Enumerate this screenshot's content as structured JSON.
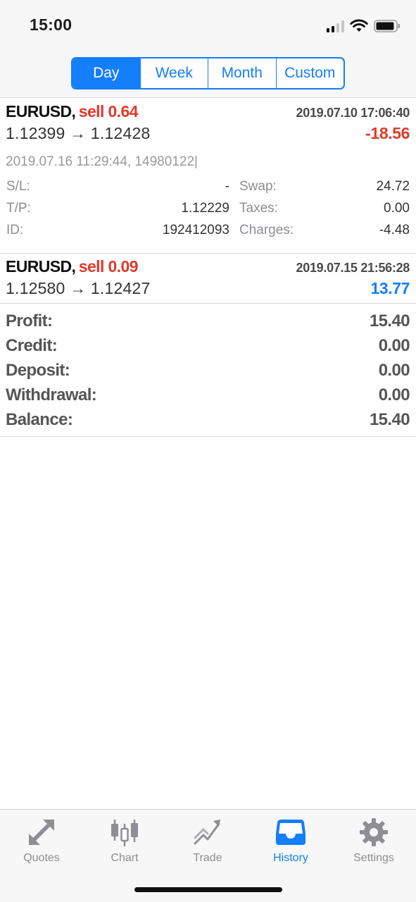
{
  "status_bar": {
    "time": "15:00"
  },
  "segments": [
    {
      "label": "Day",
      "active": true
    },
    {
      "label": "Week",
      "active": false
    },
    {
      "label": "Month",
      "active": false
    },
    {
      "label": "Custom",
      "active": false
    }
  ],
  "trades": [
    {
      "symbol": "EURUSD,",
      "side": "sell 0.64",
      "open_time": "2019.07.10 17:06:40",
      "prices": "1.12399 → 1.12428",
      "profit": "-18.56",
      "close_info": "2019.07.16 11:29:44, 14980122|",
      "details": {
        "sl_label": "S/L:",
        "sl_value": "-",
        "tp_label": "T/P:",
        "tp_value": "1.12229",
        "id_label": "ID:",
        "id_value": "192412093",
        "swap_label": "Swap:",
        "swap_value": "24.72",
        "taxes_label": "Taxes:",
        "taxes_value": "0.00",
        "charges_label": "Charges:",
        "charges_value": "-4.48"
      }
    },
    {
      "symbol": "EURUSD,",
      "side": "sell 0.09",
      "open_time": "2019.07.15 21:56:28",
      "prices": "1.12580 → 1.12427",
      "profit": "13.77"
    }
  ],
  "summary": [
    {
      "label": "Profit:",
      "value": "15.40"
    },
    {
      "label": "Credit:",
      "value": "0.00"
    },
    {
      "label": "Deposit:",
      "value": "0.00"
    },
    {
      "label": "Withdrawal:",
      "value": "0.00"
    },
    {
      "label": "Balance:",
      "value": "15.40"
    }
  ],
  "tabs": [
    {
      "label": "Quotes",
      "icon": "quotes-icon",
      "active": false
    },
    {
      "label": "Chart",
      "icon": "chart-icon",
      "active": false
    },
    {
      "label": "Trade",
      "icon": "trade-icon",
      "active": false
    },
    {
      "label": "History",
      "icon": "history-icon",
      "active": true
    },
    {
      "label": "Settings",
      "icon": "settings-icon",
      "active": false
    }
  ],
  "colors": {
    "accent": "#147efb",
    "loss": "#e03a2b",
    "inactive": "#8e8e93"
  }
}
